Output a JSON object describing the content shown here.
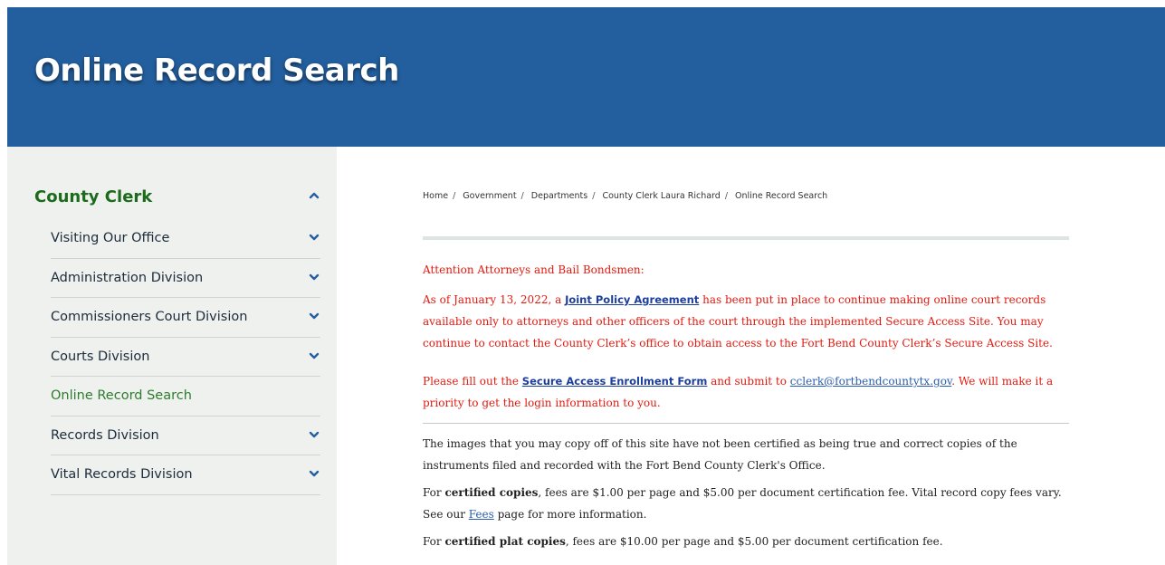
{
  "header": {
    "title": "Online Record Search"
  },
  "sidebar": {
    "title": "County Clerk",
    "items": [
      {
        "label": "Visiting Our Office"
      },
      {
        "label": "Administration Division"
      },
      {
        "label": "Commissioners Court Division"
      },
      {
        "label": "Courts Division"
      },
      {
        "label": "Online Record Search"
      },
      {
        "label": "Records Division"
      },
      {
        "label": "Vital Records Division"
      }
    ]
  },
  "breadcrumb": {
    "items": [
      "Home",
      "Government",
      "Departments",
      "County Clerk Laura Richard",
      "Online Record Search"
    ]
  },
  "notice": {
    "heading": "Attention Attorneys and Bail Bondsmen:",
    "p1_before": "As of January 13, 2022, a ",
    "p1_link": "Joint Policy Agreement",
    "p1_after": " has been put in place to continue making online court records available only to attorneys and other officers of the court through the implemented Secure Access Site. You may continue to contact the County Clerk’s office to obtain access to the Fort Bend County Clerk’s Secure Access Site.",
    "p2_before": "Please fill out the ",
    "p2_link": "Secure Access Enrollment Form",
    "p2_mid": " and submit to ",
    "p2_email": "cclerk@fortbendcountytx.gov",
    "p2_after": ".  We will make it a priority to get the login information to you."
  },
  "info": {
    "p1": "The images that you may copy off of this site have not been certified as being true and correct copies of the instruments filed and recorded with the Fort Bend County Clerk's Office.",
    "p2_before": "For ",
    "p2_bold": "certified copies",
    "p2_mid": ", fees are $1.00 per page and $5.00 per document certification fee. Vital record copy fees vary. See our ",
    "p2_link": "Fees",
    "p2_after": " page for more information.",
    "p3_before": "For ",
    "p3_bold": "certified plat copies",
    "p3_after": ", fees are $10.00 per page and $5.00 per document certification fee."
  },
  "colors": {
    "banner": "#235f9e",
    "sidebar_bg": "#eef1ee",
    "sidebar_title": "#1c6b1c",
    "chevron": "#235f9e",
    "notice_red": "#e3190f"
  },
  "icons": {
    "sidebar_title": "chevron-up-icon",
    "sidebar_item": "chevron-down-icon"
  }
}
